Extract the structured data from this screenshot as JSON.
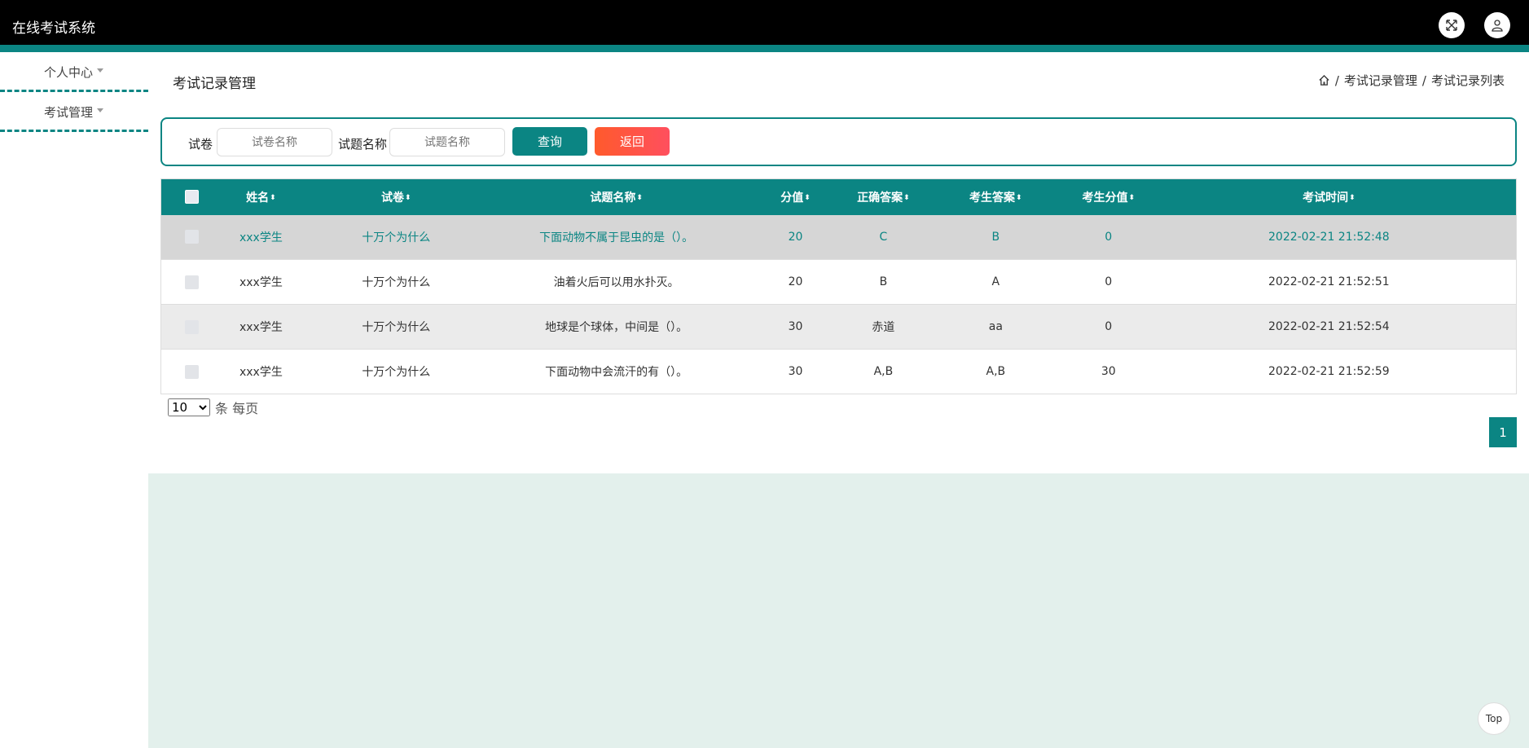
{
  "app": {
    "title": "在线考试系统"
  },
  "sidebar": {
    "items": [
      {
        "label": "个人中心"
      },
      {
        "label": "考试管理"
      }
    ]
  },
  "page": {
    "title": "考试记录管理"
  },
  "breadcrumb": {
    "items": [
      "考试记录管理",
      "考试记录列表"
    ],
    "separator": "/"
  },
  "search": {
    "paper_label": "试卷",
    "paper_placeholder": "试卷名称",
    "question_label": "试题名称",
    "question_placeholder": "试题名称",
    "query_button": "查询",
    "back_button": "返回"
  },
  "table": {
    "columns": [
      "姓名",
      "试卷",
      "试题名称",
      "分值",
      "正确答案",
      "考生答案",
      "考生分值",
      "考试时间"
    ],
    "rows": [
      {
        "name": "xxx学生",
        "paper": "十万个为什么",
        "question": "下面动物不属于昆虫的是（）。",
        "score": "20",
        "correct": "C",
        "answer": "B",
        "got": "0",
        "time": "2022-02-21 21:52:48"
      },
      {
        "name": "xxx学生",
        "paper": "十万个为什么",
        "question": "油着火后可以用水扑灭。",
        "score": "20",
        "correct": "B",
        "answer": "A",
        "got": "0",
        "time": "2022-02-21 21:52:51"
      },
      {
        "name": "xxx学生",
        "paper": "十万个为什么",
        "question": "地球是个球体，中间是（）。",
        "score": "30",
        "correct": "赤道",
        "answer": "aa",
        "got": "0",
        "time": "2022-02-21 21:52:54"
      },
      {
        "name": "xxx学生",
        "paper": "十万个为什么",
        "question": "下面动物中会流汗的有（）。",
        "score": "30",
        "correct": "A,B",
        "answer": "A,B",
        "got": "30",
        "time": "2022-02-21 21:52:59"
      }
    ]
  },
  "pager": {
    "size_value": "10",
    "size_suffix": "条 每页",
    "current_page": "1"
  },
  "back_to_top": "Top",
  "colors": {
    "accent": "#0b8583",
    "danger": "#ff5a36",
    "footer": "#e3f0ec"
  }
}
